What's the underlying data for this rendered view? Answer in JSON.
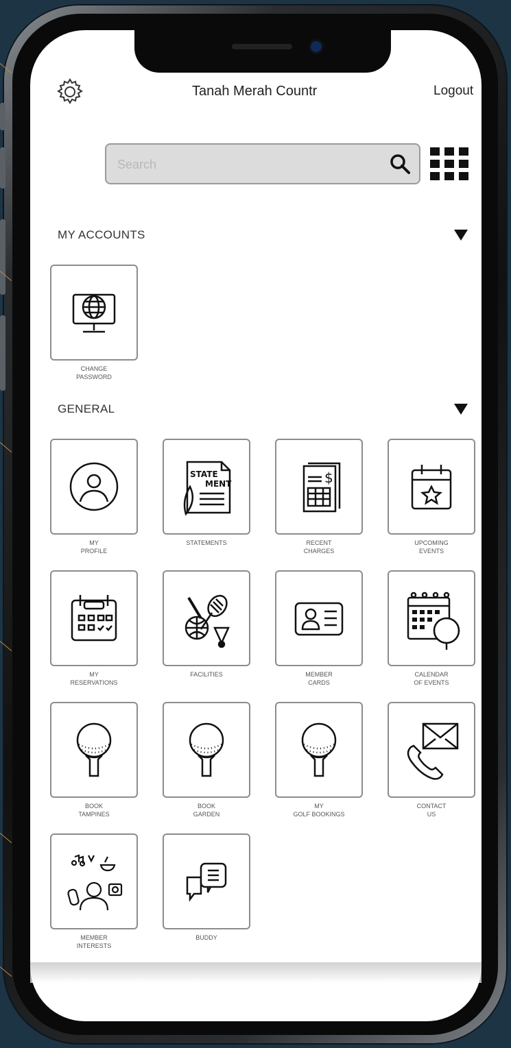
{
  "header": {
    "title": "Tanah Merah Countr",
    "logout_label": "Logout"
  },
  "search": {
    "placeholder": "Search"
  },
  "sections": [
    {
      "title": "MY ACCOUNTS"
    },
    {
      "title": "GENERAL"
    }
  ],
  "tiles": {
    "change_password": {
      "line1": "CHANGE",
      "line2": "PASSWORD",
      "icon": "globe-monitor-icon"
    },
    "my_profile": {
      "line1": "MY",
      "line2": "PROFILE",
      "icon": "user-circle-icon"
    },
    "statements": {
      "line1": "STATEMENTS",
      "line2": "",
      "icon": "statement-document-icon",
      "icon_text_1": "STATE",
      "icon_text_2": "MENT"
    },
    "recent_charges": {
      "line1": "RECENT",
      "line2": "CHARGES",
      "icon": "invoice-dollar-icon"
    },
    "upcoming_events": {
      "line1": "UPCOMING",
      "line2": "EVENTS",
      "icon": "calendar-star-icon"
    },
    "my_reservations": {
      "line1": "MY",
      "line2": "RESERVATIONS",
      "icon": "calendar-check-icon"
    },
    "facilities": {
      "line1": "FACILITIES",
      "line2": "",
      "icon": "sports-equipment-icon"
    },
    "member_cards": {
      "line1": "MEMBER",
      "line2": "CARDS",
      "icon": "id-card-icon"
    },
    "calendar_of_events": {
      "line1": "CALENDAR",
      "line2": "OF EVENTS",
      "icon": "calendar-golf-icon"
    },
    "book_tampines": {
      "line1": "BOOK",
      "line2": "TAMPINES",
      "icon": "golf-ball-tee-icon"
    },
    "book_garden": {
      "line1": "BOOK",
      "line2": "GARDEN",
      "icon": "golf-ball-tee-icon"
    },
    "my_golf_bookings": {
      "line1": "MY",
      "line2": "GOLF BOOKINGS",
      "icon": "golf-ball-tee-icon"
    },
    "contact_us": {
      "line1": "CONTACT",
      "line2": "US",
      "icon": "phone-envelope-icon"
    },
    "member_interests": {
      "line1": "MEMBER",
      "line2": "INTERESTS",
      "icon": "interests-person-icon"
    },
    "buddy": {
      "line1": "BUDDY",
      "line2": "",
      "icon": "chat-bubbles-icon"
    }
  },
  "colors": {
    "background": "#1d3444",
    "screen": "#ffffff",
    "tile_border": "#8c8c8c",
    "search_fill": "#dcdcdc"
  }
}
